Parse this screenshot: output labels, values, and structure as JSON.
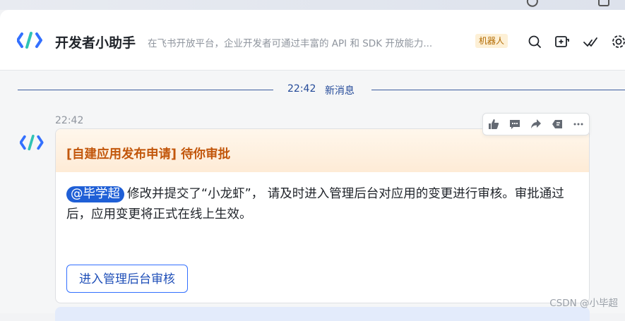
{
  "header": {
    "bot_name": "开发者小助手",
    "description": "在飞书开放平台，企业开发者可通过丰富的 API 和 SDK 开放能力...",
    "badge": "机器人",
    "icons": [
      "search-icon",
      "add-window-icon",
      "checkmark-icon",
      "gear-icon"
    ]
  },
  "divider": {
    "time": "22:42",
    "label": "新消息"
  },
  "message": {
    "time": "22:42",
    "toolbar_icons": [
      "thumbs-up-icon",
      "comment-icon",
      "share-icon",
      "reply-icon",
      "more-icon"
    ],
    "card": {
      "title": "[自建应用发布申请] 待你审批",
      "mention": "@毕学超",
      "body": "修改并提交了“小龙虾”， 请及时进入管理后台对应用的变更进行审核。审批通过后，应用变更将正式在线上生效。",
      "button_label": "进入管理后台审核"
    }
  },
  "watermark": "CSDN @小毕超",
  "colors": {
    "accent_blue": "#3370ff",
    "card_title": "#c2570c",
    "badge_bg": "#fdf0d6",
    "divider": "#244a99"
  }
}
